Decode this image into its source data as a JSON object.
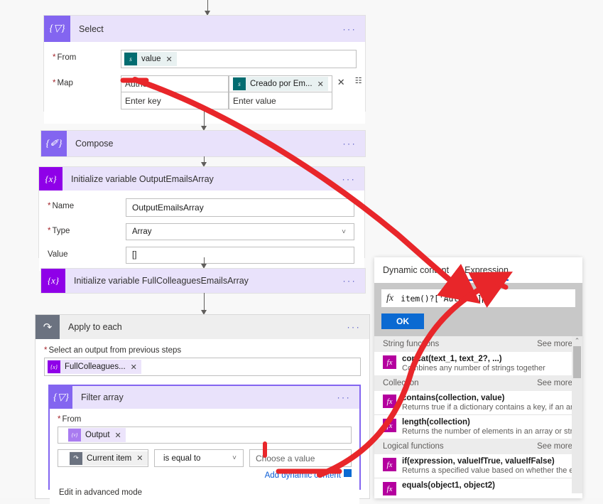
{
  "canvas": {
    "background": "#f8f8f8",
    "accent_violet": "#8365f0",
    "accent_purple": "#8f00e8",
    "accent_blue": "#0b5cd5",
    "annotation_color": "#e8262a"
  },
  "actions": {
    "select": {
      "title": "Select",
      "icon": "select-icon",
      "icon_glyph": "{▽}",
      "ellipsis": "···",
      "from_label": "From",
      "from_token": {
        "text": "value",
        "icon": "sharepoint-icon",
        "remove": "✕"
      },
      "map_label": "Map",
      "map_rows": [
        {
          "key": "Author",
          "key_placeholder": "",
          "value_token": {
            "text": "Creado por Em...",
            "icon": "sharepoint-icon",
            "remove": "✕"
          },
          "value_placeholder": ""
        },
        {
          "key": "",
          "key_placeholder": "Enter key",
          "value_token": null,
          "value_placeholder": "Enter value"
        }
      ],
      "delete_icon": "✕",
      "switch_icon": "⏷"
    },
    "compose": {
      "title": "Compose",
      "icon": "compose-icon",
      "icon_glyph": "{✐}",
      "ellipsis": "···"
    },
    "init_output": {
      "title": "Initialize variable OutputEmailsArray",
      "icon": "variable-icon",
      "icon_glyph": "{x}",
      "ellipsis": "···",
      "fields": [
        {
          "label": "Name",
          "required": true,
          "value": "OutputEmailsArray",
          "type": "text"
        },
        {
          "label": "Type",
          "required": true,
          "value": "Array",
          "type": "select"
        },
        {
          "label": "Value",
          "required": false,
          "value": "[]",
          "type": "text"
        }
      ]
    },
    "init_colleagues": {
      "title": "Initialize variable FullColleaguesEmailsArray",
      "icon": "variable-icon",
      "icon_glyph": "{x}",
      "ellipsis": "···"
    },
    "apply_to_each": {
      "title": "Apply to each",
      "icon": "loop-icon",
      "icon_glyph": "↺",
      "ellipsis": "···",
      "select_output_label": "Select an output from previous steps",
      "output_token": {
        "text": "FullColleagues...",
        "icon": "variable-icon",
        "remove": "✕"
      }
    },
    "filter_array": {
      "title": "Filter array",
      "icon": "filter-icon",
      "icon_glyph": "{▽}",
      "ellipsis": "···",
      "from_label": "From",
      "from_token": {
        "text": "Output",
        "icon": "variable-icon",
        "remove": "✕"
      },
      "condition": {
        "left_token": {
          "text": "Current item",
          "icon": "loop-icon",
          "remove": "✕"
        },
        "operator": "is equal to",
        "right_placeholder": "Choose a value"
      },
      "add_dynamic_content": "Add dynamic content",
      "add_dynamic_badge": "▪",
      "edit_advanced": "Edit in advanced mode"
    }
  },
  "dynamic_content_panel": {
    "tabs": [
      {
        "label": "Dynamic content",
        "active": false
      },
      {
        "label": "Expression",
        "active": true
      }
    ],
    "expression": {
      "fx_label": "fx",
      "value": "item()?['Author']",
      "ok_label": "OK"
    },
    "see_more_label": "See more",
    "groups": [
      {
        "name": "String functions",
        "items": [
          {
            "name": "concat(text_1, text_2?, ...)",
            "description": "Combines any number of strings together",
            "icon": "function-icon"
          }
        ]
      },
      {
        "name": "Collection",
        "items": [
          {
            "name": "contains(collection, value)",
            "description": "Returns true if a dictionary contains a key, if an array cont...",
            "icon": "function-icon"
          },
          {
            "name": "length(collection)",
            "description": "Returns the number of elements in an array or string",
            "icon": "function-icon"
          }
        ]
      },
      {
        "name": "Logical functions",
        "items": [
          {
            "name": "if(expression, valueIfTrue, valueIfFalse)",
            "description": "Returns a specified value based on whether the expressio...",
            "icon": "function-icon"
          },
          {
            "name": "equals(object1, object2)",
            "description": "",
            "icon": "function-icon"
          }
        ]
      }
    ],
    "scrollbar": {
      "up_arrow": "⌃"
    }
  }
}
